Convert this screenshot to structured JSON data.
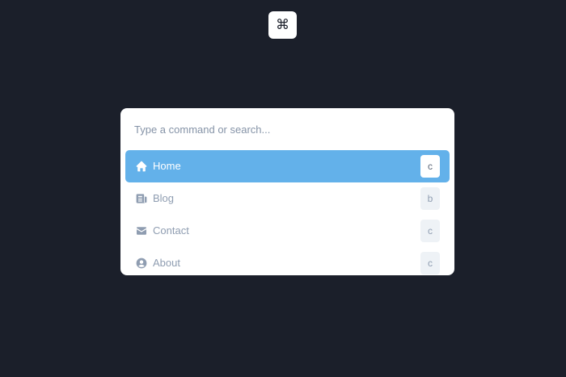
{
  "trigger": {
    "glyph": "⌘",
    "icon": "command-icon"
  },
  "search": {
    "placeholder": "Type a command or search...",
    "value": ""
  },
  "items": [
    {
      "label": "Home",
      "shortcut": "c",
      "icon": "home-icon",
      "active": true
    },
    {
      "label": "Blog",
      "shortcut": "b",
      "icon": "newspaper-icon",
      "active": false
    },
    {
      "label": "Contact",
      "shortcut": "c",
      "icon": "mail-icon",
      "active": false
    },
    {
      "label": "About",
      "shortcut": "c",
      "icon": "user-circle-icon",
      "active": false
    }
  ],
  "colors": {
    "background": "#1b1f2a",
    "accent": "#63b1ea",
    "muted_text": "#8f9db1",
    "kbd_bg": "#eef2f6"
  }
}
